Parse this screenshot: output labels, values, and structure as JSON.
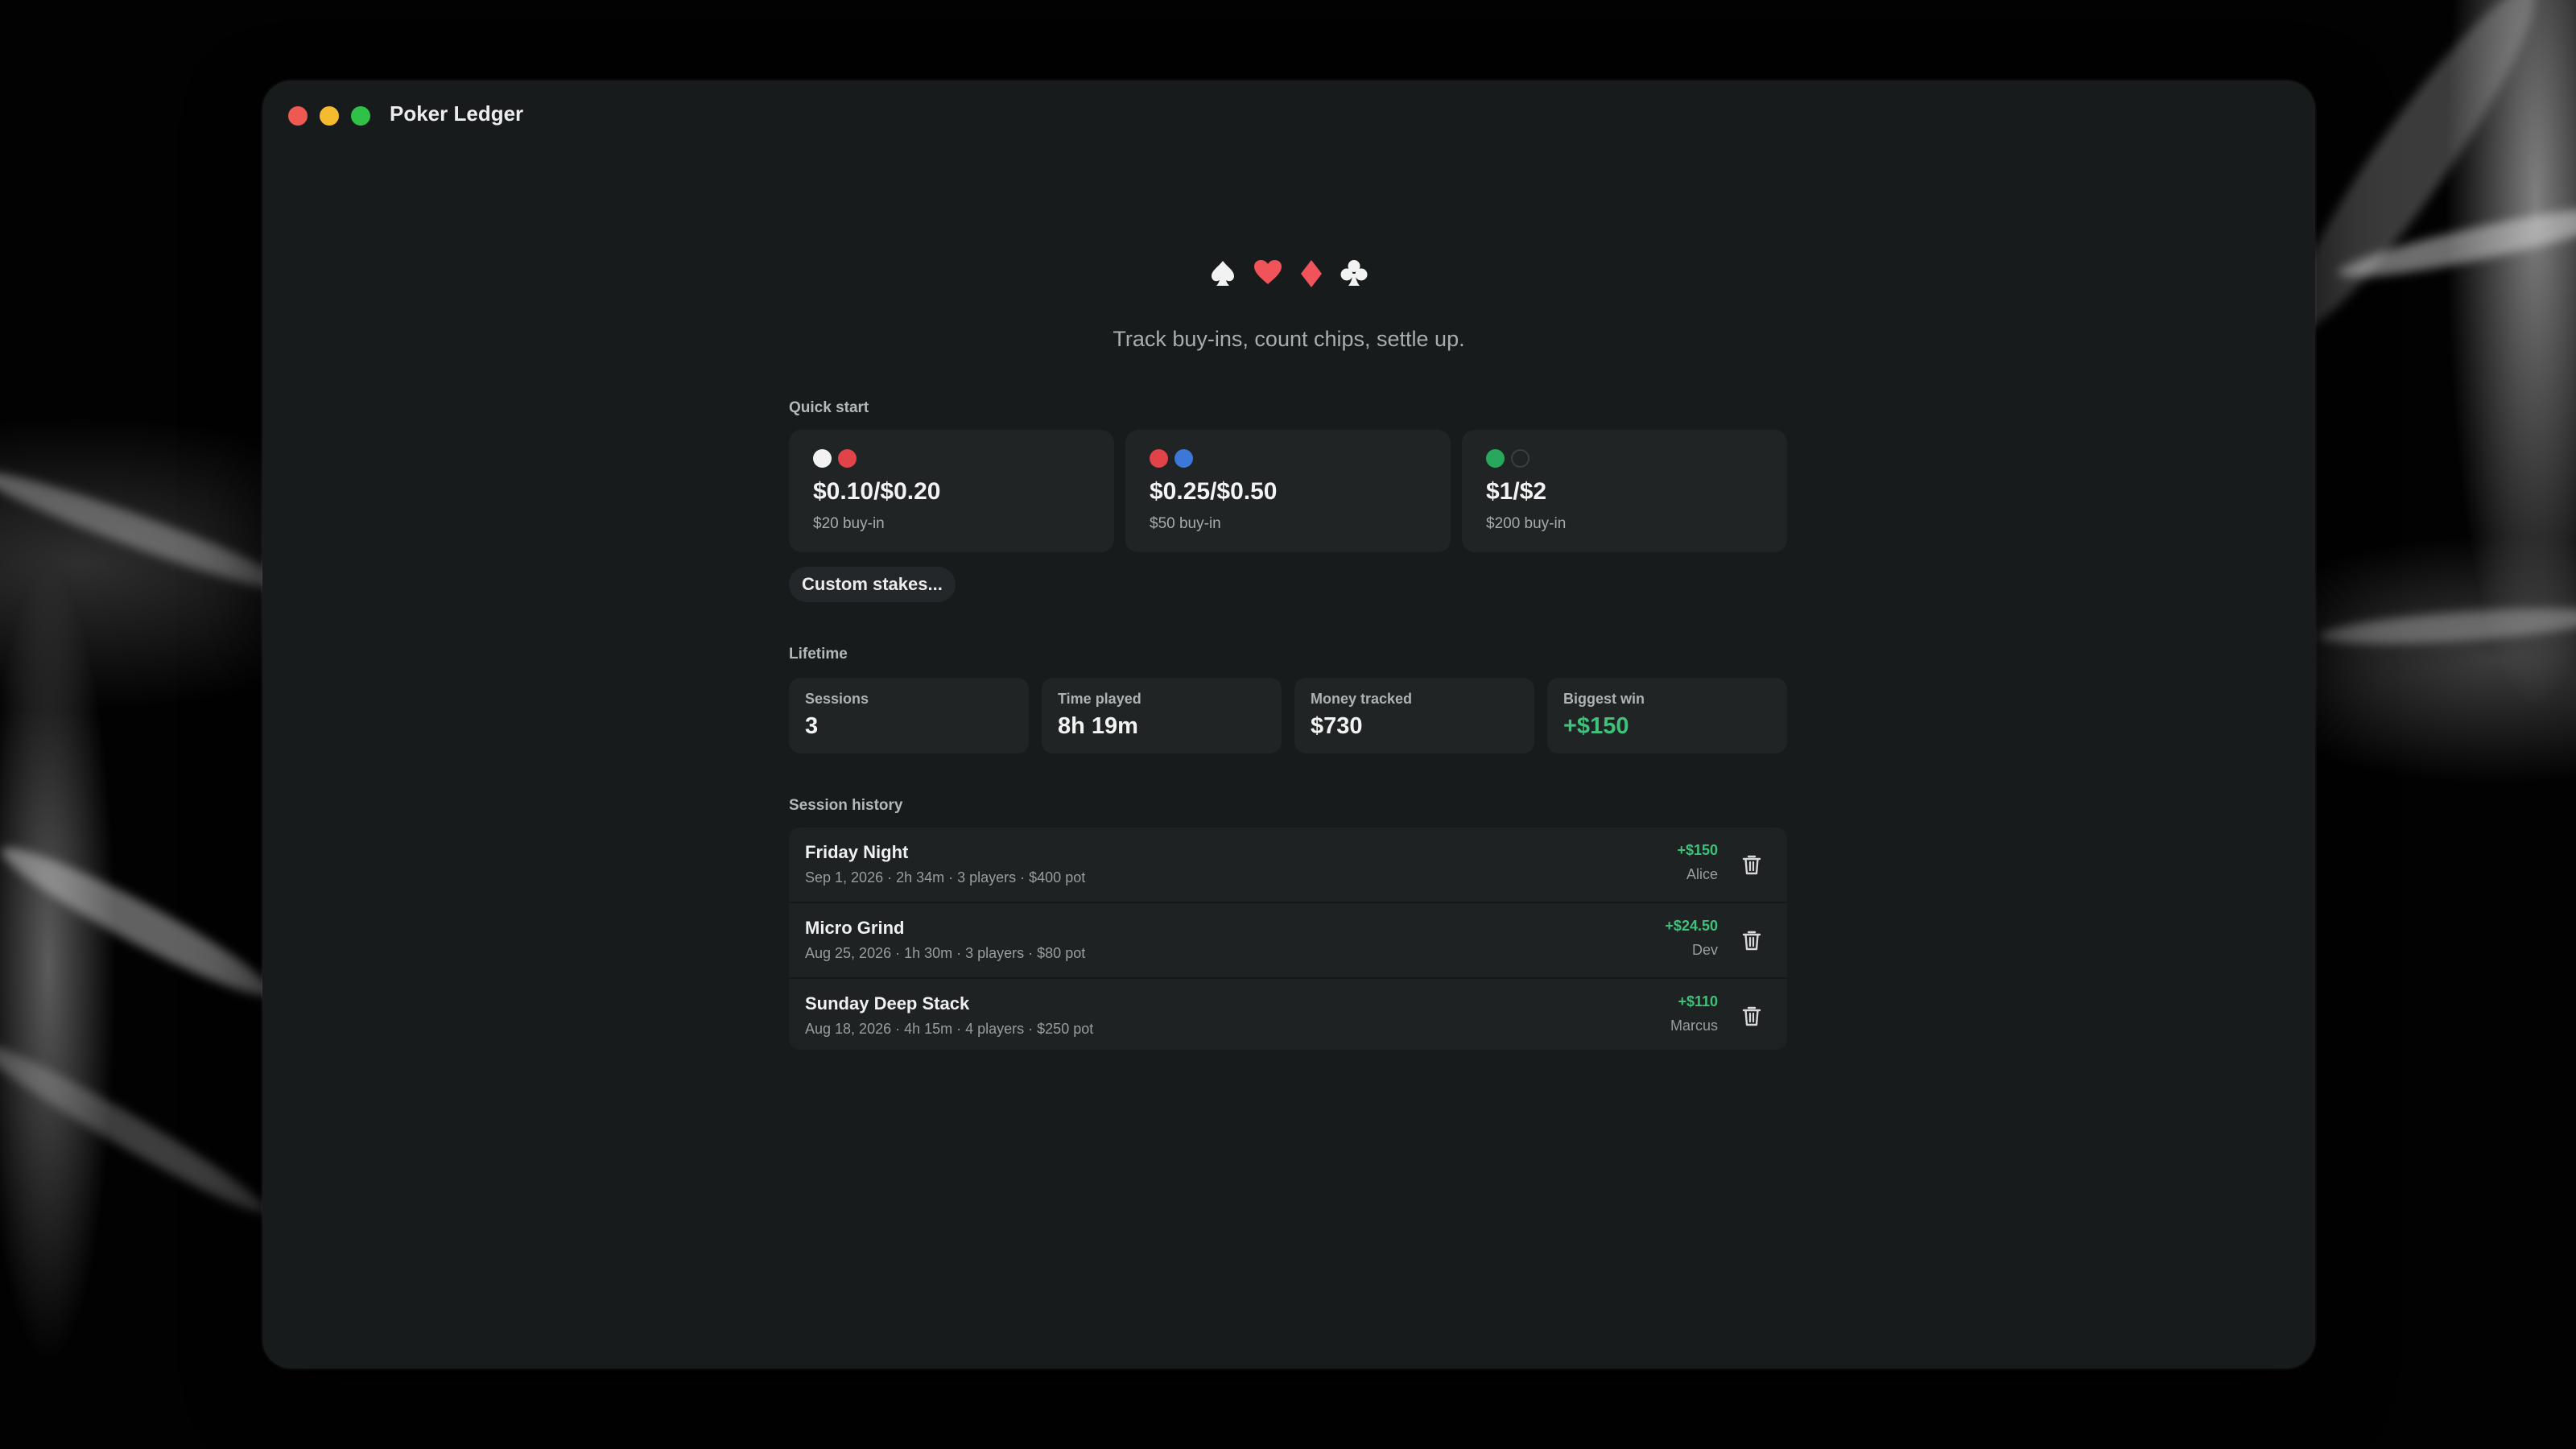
{
  "window": {
    "title": "Poker Ledger"
  },
  "header": {
    "suits": [
      "spade",
      "heart",
      "diamond",
      "club"
    ],
    "suit_colors": {
      "spade": "#f2f2f2",
      "heart": "#f0545a",
      "diamond": "#f0545a",
      "club": "#f2f2f2"
    },
    "tagline": "Track buy-ins, count chips, settle up."
  },
  "quick_start": {
    "label": "Quick start",
    "stakes": [
      {
        "value": "$0.10/$0.20",
        "buyin": "$20 buy-in",
        "chip_colors": [
          "#f2f2f2",
          "#e04448"
        ]
      },
      {
        "value": "$0.25/$0.50",
        "buyin": "$50 buy-in",
        "chip_colors": [
          "#e04448",
          "#3b78d8"
        ]
      },
      {
        "value": "$1/$2",
        "buyin": "$200 buy-in",
        "chip_colors": [
          "#27a85c",
          "#202425"
        ]
      }
    ],
    "custom_label": "Custom stakes..."
  },
  "lifetime": {
    "label": "Lifetime",
    "stats": [
      {
        "label": "Sessions",
        "value": "3"
      },
      {
        "label": "Time played",
        "value": "8h 19m"
      },
      {
        "label": "Money tracked",
        "value": "$730"
      },
      {
        "label": "Biggest win",
        "value": "+$150",
        "color": "#3ec27a"
      }
    ]
  },
  "history": {
    "label": "Session history",
    "sessions": [
      {
        "name": "Friday Night",
        "meta": "Sep 1, 2026 · 2h 34m · 3 players · $400 pot",
        "amount": "+$150",
        "winner": "Alice"
      },
      {
        "name": "Micro Grind",
        "meta": "Aug 25, 2026 · 1h 30m · 3 players · $80 pot",
        "amount": "+$24.50",
        "winner": "Dev"
      },
      {
        "name": "Sunday Deep Stack",
        "meta": "Aug 18, 2026 · 4h 15m · 4 players · $250 pot",
        "amount": "+$110",
        "winner": "Marcus"
      }
    ]
  },
  "colors": {
    "accent_green": "#3ec27a",
    "window_bg": "#181b1c",
    "card_bg": "#202425"
  }
}
